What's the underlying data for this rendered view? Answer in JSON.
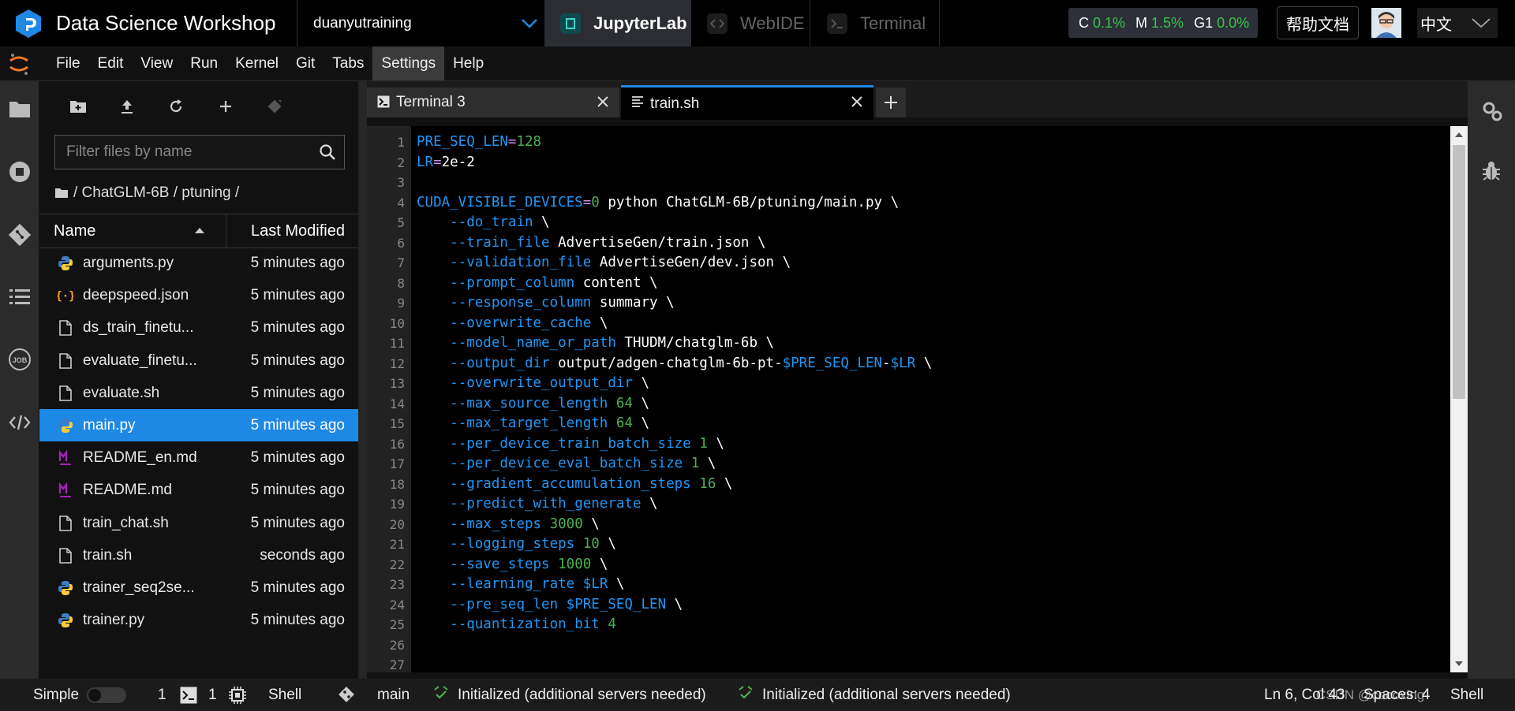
{
  "app": {
    "title": "Data Science Workshop",
    "workspace": "duanyutraining",
    "app_tabs": [
      {
        "label": "JupyterLab",
        "active": true
      },
      {
        "label": "WebIDE",
        "active": false
      },
      {
        "label": "Terminal",
        "active": false
      }
    ],
    "resources": [
      {
        "key": "C",
        "value": "0.1%"
      },
      {
        "key": "M",
        "value": "1.5%"
      },
      {
        "key": "G1",
        "value": "0.0%"
      }
    ],
    "help_label": "帮助文档",
    "language": "中文",
    "accent_color": "#1e88e5"
  },
  "menu": {
    "items": [
      "File",
      "Edit",
      "View",
      "Run",
      "Kernel",
      "Git",
      "Tabs",
      "Settings",
      "Help"
    ],
    "open_item": "Settings"
  },
  "filebrowser": {
    "filter_placeholder": "Filter files by name",
    "breadcrumb": "/ ChatGLM-6B / ptuning /",
    "col_name": "Name",
    "col_modified": "Last Modified",
    "files": [
      {
        "name": "arguments.py",
        "time": "5 minutes ago",
        "icon": "python-icon"
      },
      {
        "name": "deepspeed.json",
        "time": "5 minutes ago",
        "icon": "json-icon"
      },
      {
        "name": "ds_train_finetu...",
        "time": "5 minutes ago",
        "icon": "file-icon"
      },
      {
        "name": "evaluate_finetu...",
        "time": "5 minutes ago",
        "icon": "file-icon"
      },
      {
        "name": "evaluate.sh",
        "time": "5 minutes ago",
        "icon": "file-icon"
      },
      {
        "name": "main.py",
        "time": "5 minutes ago",
        "icon": "python-icon",
        "selected": true
      },
      {
        "name": "README_en.md",
        "time": "5 minutes ago",
        "icon": "markdown-icon"
      },
      {
        "name": "README.md",
        "time": "5 minutes ago",
        "icon": "markdown-icon"
      },
      {
        "name": "train_chat.sh",
        "time": "5 minutes ago",
        "icon": "file-icon"
      },
      {
        "name": "train.sh",
        "time": "seconds ago",
        "icon": "file-icon"
      },
      {
        "name": "trainer_seq2se...",
        "time": "5 minutes ago",
        "icon": "python-icon"
      },
      {
        "name": "trainer.py",
        "time": "5 minutes ago",
        "icon": "python-icon"
      }
    ]
  },
  "tabs": [
    {
      "label": "Terminal 3"
    },
    {
      "label": "train.sh",
      "active": true
    }
  ],
  "editor": {
    "line_numbers": [
      "1",
      "2",
      "3",
      "4",
      "5",
      "6",
      "7",
      "8",
      "9",
      "10",
      "11",
      "12",
      "13",
      "14",
      "15",
      "16",
      "17",
      "18",
      "19",
      "20",
      "21",
      "22",
      "23",
      "24",
      "25",
      "26",
      "27"
    ],
    "lines": [
      [
        [
          "vn",
          "PRE_SEQ_LEN"
        ],
        [
          "op",
          "="
        ],
        [
          "nu",
          "128"
        ]
      ],
      [
        [
          "vn",
          "LR"
        ],
        [
          "op",
          "="
        ],
        [
          "tx",
          "2e-2"
        ]
      ],
      [],
      [
        [
          "vn",
          "CUDA_VISIBLE_DEVICES"
        ],
        [
          "op",
          "="
        ],
        [
          "nu",
          "0"
        ],
        [
          "tx",
          " python ChatGLM-6B/ptuning/main.py \\"
        ]
      ],
      [
        [
          "tx",
          "    "
        ],
        [
          "fl",
          "--do_train"
        ],
        [
          "tx",
          " \\"
        ]
      ],
      [
        [
          "tx",
          "    "
        ],
        [
          "fl",
          "--train_file"
        ],
        [
          "tx",
          " AdvertiseGen/train.json \\"
        ]
      ],
      [
        [
          "tx",
          "    "
        ],
        [
          "fl",
          "--validation_file"
        ],
        [
          "tx",
          " AdvertiseGen/dev.json \\"
        ]
      ],
      [
        [
          "tx",
          "    "
        ],
        [
          "fl",
          "--prompt_column"
        ],
        [
          "tx",
          " content \\"
        ]
      ],
      [
        [
          "tx",
          "    "
        ],
        [
          "fl",
          "--response_column"
        ],
        [
          "tx",
          " summary \\"
        ]
      ],
      [
        [
          "tx",
          "    "
        ],
        [
          "fl",
          "--overwrite_cache"
        ],
        [
          "tx",
          " \\"
        ]
      ],
      [
        [
          "tx",
          "    "
        ],
        [
          "fl",
          "--model_name_or_path"
        ],
        [
          "tx",
          " THUDM/chatglm-6b \\"
        ]
      ],
      [
        [
          "tx",
          "    "
        ],
        [
          "fl",
          "--output_dir"
        ],
        [
          "tx",
          " output/adgen-chatglm-6b-pt-"
        ],
        [
          "vn",
          "$PRE_SEQ_LEN"
        ],
        [
          "tx",
          "-"
        ],
        [
          "vn",
          "$LR"
        ],
        [
          "tx",
          " \\"
        ]
      ],
      [
        [
          "tx",
          "    "
        ],
        [
          "fl",
          "--overwrite_output_dir"
        ],
        [
          "tx",
          " \\"
        ]
      ],
      [
        [
          "tx",
          "    "
        ],
        [
          "fl",
          "--max_source_length"
        ],
        [
          "tx",
          " "
        ],
        [
          "nu",
          "64"
        ],
        [
          "tx",
          " \\"
        ]
      ],
      [
        [
          "tx",
          "    "
        ],
        [
          "fl",
          "--max_target_length"
        ],
        [
          "tx",
          " "
        ],
        [
          "nu",
          "64"
        ],
        [
          "tx",
          " \\"
        ]
      ],
      [
        [
          "tx",
          "    "
        ],
        [
          "fl",
          "--per_device_train_batch_size"
        ],
        [
          "tx",
          " "
        ],
        [
          "nu",
          "1"
        ],
        [
          "tx",
          " \\"
        ]
      ],
      [
        [
          "tx",
          "    "
        ],
        [
          "fl",
          "--per_device_eval_batch_size"
        ],
        [
          "tx",
          " "
        ],
        [
          "nu",
          "1"
        ],
        [
          "tx",
          " \\"
        ]
      ],
      [
        [
          "tx",
          "    "
        ],
        [
          "fl",
          "--gradient_accumulation_steps"
        ],
        [
          "tx",
          " "
        ],
        [
          "nu",
          "16"
        ],
        [
          "tx",
          " \\"
        ]
      ],
      [
        [
          "tx",
          "    "
        ],
        [
          "fl",
          "--predict_with_generate"
        ],
        [
          "tx",
          " \\"
        ]
      ],
      [
        [
          "tx",
          "    "
        ],
        [
          "fl",
          "--max_steps"
        ],
        [
          "tx",
          " "
        ],
        [
          "nu",
          "3000"
        ],
        [
          "tx",
          " \\"
        ]
      ],
      [
        [
          "tx",
          "    "
        ],
        [
          "fl",
          "--logging_steps"
        ],
        [
          "tx",
          " "
        ],
        [
          "nu",
          "10"
        ],
        [
          "tx",
          " \\"
        ]
      ],
      [
        [
          "tx",
          "    "
        ],
        [
          "fl",
          "--save_steps"
        ],
        [
          "tx",
          " "
        ],
        [
          "nu",
          "1000"
        ],
        [
          "tx",
          " \\"
        ]
      ],
      [
        [
          "tx",
          "    "
        ],
        [
          "fl",
          "--learning_rate"
        ],
        [
          "tx",
          " "
        ],
        [
          "vn",
          "$LR"
        ],
        [
          "tx",
          " \\"
        ]
      ],
      [
        [
          "tx",
          "    "
        ],
        [
          "fl",
          "--pre_seq_len"
        ],
        [
          "tx",
          " "
        ],
        [
          "vn",
          "$PRE_SEQ_LEN"
        ],
        [
          "tx",
          " \\"
        ]
      ],
      [
        [
          "tx",
          "    "
        ],
        [
          "fl",
          "--quantization_bit"
        ],
        [
          "tx",
          " "
        ],
        [
          "nu",
          "4"
        ]
      ],
      [],
      []
    ]
  },
  "statusbar": {
    "simple_label": "Simple",
    "terminals_count": "1",
    "kernels_count": "1",
    "shell_label": "Shell",
    "branch": "main",
    "lsp_status_1": "Initialized (additional servers needed)",
    "lsp_status_2": "Initialized (additional servers needed)",
    "cursor": "Ln 6, Col 43",
    "spaces": "Spaces: 4",
    "filetype": "Shell",
    "watermark": "CSDN @cocoxing"
  }
}
